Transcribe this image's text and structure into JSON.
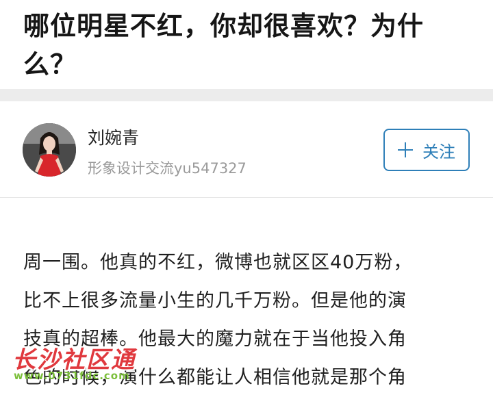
{
  "question": {
    "title": "哪位明星不红，你却很喜欢？为什么？"
  },
  "author": {
    "name": "刘婉青",
    "description": "形象设计交流yu547327",
    "avatar_icon": "person-photo-avatar"
  },
  "follow_button": {
    "icon": "plus-icon",
    "label": "关注",
    "color": "#2e7fb8"
  },
  "answer": {
    "lines": [
      "周一围。他真的不红，微博也就区区40万粉，",
      "比不上很多流量小生的几千万粉。但是他的演",
      "技真的超棒。他最大的魔力就在于当他投入角",
      "色的时候，演什么都能让人相信他就是那个角"
    ]
  },
  "watermark": {
    "title": "长沙社区通",
    "url": "www.0731fdc.com",
    "title_color": "#e0393e",
    "url_color": "#7bbf3a"
  }
}
